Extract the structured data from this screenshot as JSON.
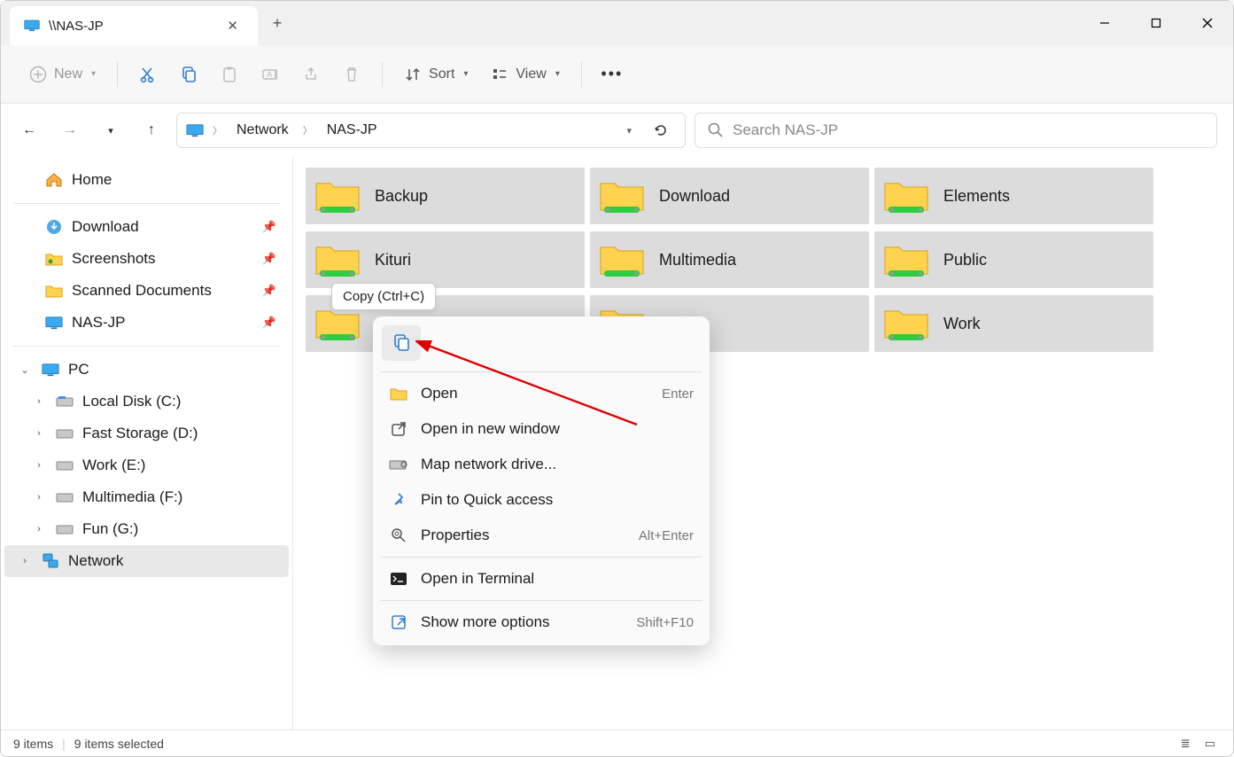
{
  "titlebar": {
    "tab_title": "\\\\NAS-JP"
  },
  "toolbar": {
    "new_label": "New",
    "sort_label": "Sort",
    "view_label": "View"
  },
  "address": {
    "root": "Network",
    "location": "NAS-JP"
  },
  "search": {
    "placeholder": "Search NAS-JP"
  },
  "sidebar": {
    "home": "Home",
    "download": "Download",
    "screenshots": "Screenshots",
    "scanned": "Scanned Documents",
    "nasjp": "NAS-JP",
    "pc": "PC",
    "localc": "Local Disk (C:)",
    "fastd": "Fast Storage (D:)",
    "worke": "Work (E:)",
    "multif": "Multimedia (F:)",
    "fung": "Fun (G:)",
    "network": "Network"
  },
  "folders": [
    "Backup",
    "Download",
    "Elements",
    "Kituri",
    "Multimedia",
    "Public",
    "",
    "",
    "Work"
  ],
  "context": {
    "open": "Open",
    "open_new": "Open in new window",
    "map": "Map network drive...",
    "pin": "Pin to Quick access",
    "props": "Properties",
    "terminal": "Open in Terminal",
    "more": "Show more options",
    "s_open": "Enter",
    "s_props": "Alt+Enter",
    "s_more": "Shift+F10"
  },
  "tooltip": {
    "copy": "Copy (Ctrl+C)"
  },
  "status": {
    "items": "9 items",
    "selected": "9 items selected"
  }
}
